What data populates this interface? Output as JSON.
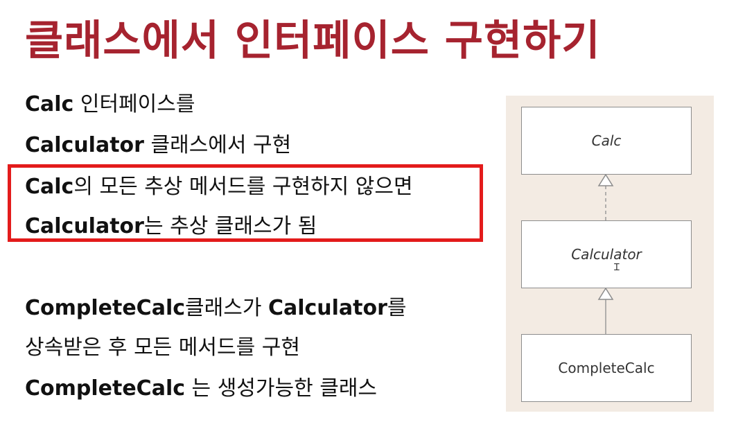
{
  "title": "클래스에서 인터페이스 구현하기",
  "lines": [
    {
      "bold": "Calc",
      "rest": " 인터페이스를"
    },
    {
      "bold": "Calculator",
      "rest": " 클래스에서 구현"
    },
    {
      "bold": "Calc",
      "rest": "의 모든 추상 메서드를 구현하지 않으면"
    },
    {
      "bold": "Calculator",
      "rest": "는 추상 클래스가 됨"
    },
    {
      "bold": "CompleteCalc",
      "rest": "클래스가 ",
      "bold2": "Calculator",
      "rest2": "를"
    },
    {
      "bold": "",
      "rest": "상속받은 후 모든 메서드를 구현"
    },
    {
      "bold": "CompleteCalc",
      "rest": " 는 생성가능한 클래스"
    }
  ],
  "diagram": {
    "classes": [
      {
        "name": "Calc",
        "kind": "interface"
      },
      {
        "name": "Calculator",
        "kind": "abstract"
      },
      {
        "name": "CompleteCalc",
        "kind": "concrete"
      }
    ],
    "relations": [
      {
        "from": "Calculator",
        "to": "Calc",
        "type": "realization"
      },
      {
        "from": "CompleteCalc",
        "to": "Calculator",
        "type": "generalization"
      }
    ]
  },
  "colors": {
    "title": "#a6232f",
    "highlight": "#e31b1b",
    "diagram_background": "#f3ebe3"
  }
}
